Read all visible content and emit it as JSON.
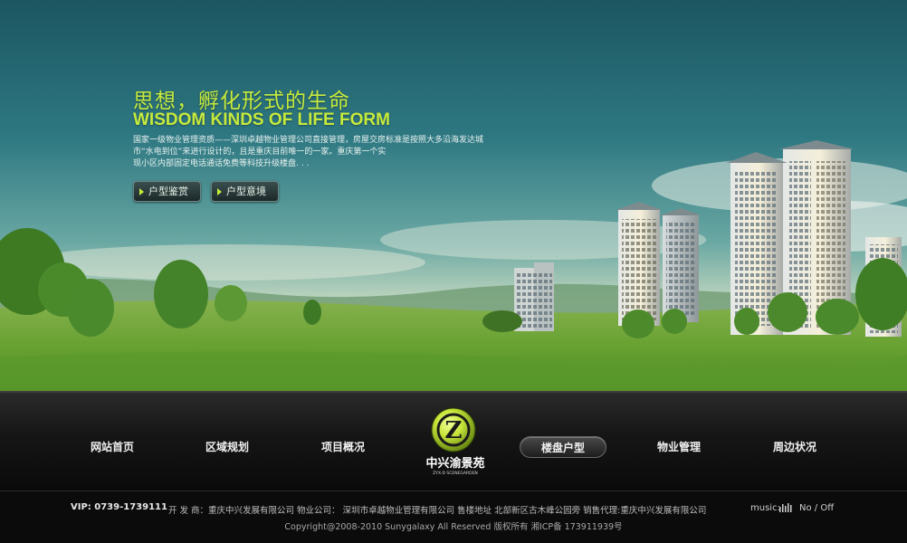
{
  "hero": {
    "headline_cn": "思想，孵化形式的生命",
    "headline_en": "WISDOM KINDS OF LIFE FORM",
    "intro_lines": [
      "国家一级物业管理资质——深圳卓越物业管理公司直接管理，房屋交房标准是按照大多沿海发达城",
      "市“水电到位”来进行设计的，且是重庆目前唯一的一家。重庆第一个实",
      "现小区内部固定电话通话免费等科技升级楼盘. . ."
    ],
    "buttons": [
      {
        "label": "户型鉴赏"
      },
      {
        "label": "户型意境"
      }
    ]
  },
  "nav": {
    "items": [
      {
        "label": "网站首页",
        "active": false
      },
      {
        "label": "区域规划",
        "active": false
      },
      {
        "label": "项目概况",
        "active": false
      },
      {
        "label": "楼盘户型",
        "active": true
      },
      {
        "label": "物业管理",
        "active": false
      },
      {
        "label": "周边状况",
        "active": false
      }
    ],
    "logo": {
      "title": "中兴渝景苑",
      "subtitle": "ZYX-D SCENEGARDEN",
      "letter": "Z"
    }
  },
  "footer": {
    "vip": "VIP: 0739-1739111",
    "info": "开 发 商：重庆中兴发展有限公司  物业公司：  深圳市卓越物业管理有限公司  售楼地址 北部新区古木峰公园旁  销售代理:重庆中兴发展有限公司",
    "music_label": "music:",
    "music_toggle": "No / Off",
    "copyright": "Copyright@2008-2010 Sunygalaxy All Reserved  版权所有 湘ICP备 173911939号"
  },
  "colors": {
    "accent_green": "#c6ea3c",
    "nav_bg": "#151515",
    "footer_bg": "#0b0b0b"
  }
}
